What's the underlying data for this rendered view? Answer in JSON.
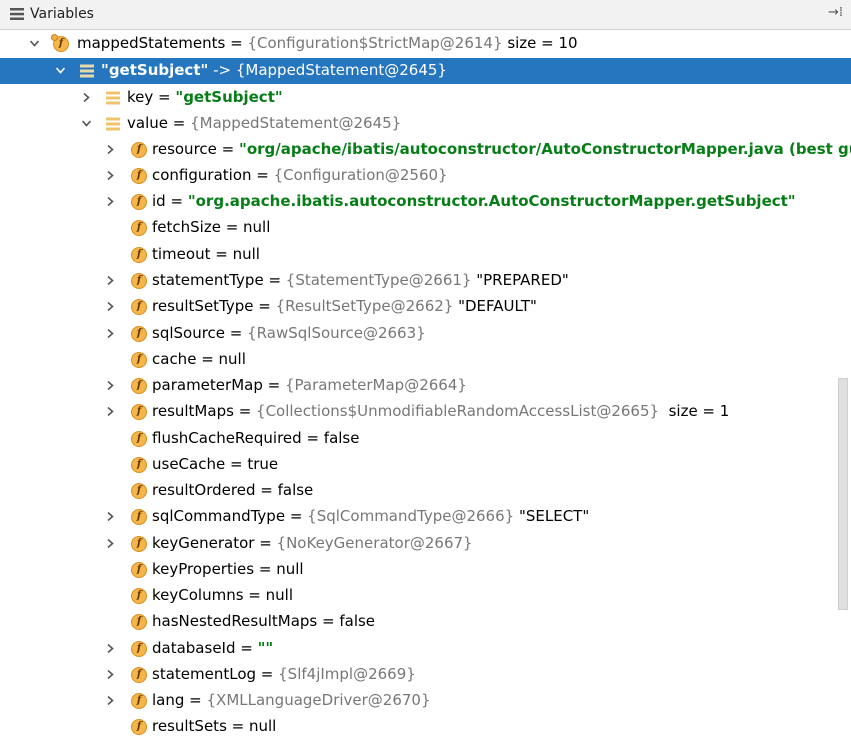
{
  "header": {
    "title": "Variables",
    "pin_glyph": "→⁞"
  },
  "tree": {
    "mappedStatements": {
      "name": "mappedStatements",
      "eq": " = ",
      "type": "{Configuration$StrictMap@2614}",
      "extra": "size = 10"
    },
    "entry": {
      "key": "\"getSubject\"",
      "arrow": " -> ",
      "type": "{MappedStatement@2645}"
    },
    "key": {
      "name": "key",
      "eq": " = ",
      "value": "\"getSubject\""
    },
    "value": {
      "name": "value",
      "eq": " = ",
      "type": "{MappedStatement@2645}"
    },
    "fields": [
      {
        "name": "resource",
        "eq": " = ",
        "str": "\"org/apache/ibatis/autoconstructor/AutoConstructorMapper.java (best guess)\"",
        "type": "",
        "plain": ""
      },
      {
        "name": "configuration",
        "eq": " = ",
        "str": "",
        "type": "{Configuration@2560}",
        "plain": ""
      },
      {
        "name": "id",
        "eq": " = ",
        "str": "\"org.apache.ibatis.autoconstructor.AutoConstructorMapper.getSubject\"",
        "type": "",
        "plain": ""
      },
      {
        "name": "fetchSize",
        "eq": " = ",
        "str": "",
        "type": "",
        "plain": "null"
      },
      {
        "name": "timeout",
        "eq": " = ",
        "str": "",
        "type": "",
        "plain": "null"
      },
      {
        "name": "statementType",
        "eq": " = ",
        "str": "",
        "type": "{StatementType@2661}",
        "plain": " \"PREPARED\""
      },
      {
        "name": "resultSetType",
        "eq": " = ",
        "str": "",
        "type": "{ResultSetType@2662}",
        "plain": " \"DEFAULT\""
      },
      {
        "name": "sqlSource",
        "eq": " = ",
        "str": "",
        "type": "{RawSqlSource@2663}",
        "plain": ""
      },
      {
        "name": "cache",
        "eq": " = ",
        "str": "",
        "type": "",
        "plain": "null"
      },
      {
        "name": "parameterMap",
        "eq": " = ",
        "str": "",
        "type": "{ParameterMap@2664}",
        "plain": ""
      },
      {
        "name": "resultMaps",
        "eq": " = ",
        "str": "",
        "type": "{Collections$UnmodifiableRandomAccessList@2665}",
        "plain": "  size = 1"
      },
      {
        "name": "flushCacheRequired",
        "eq": " = ",
        "str": "",
        "type": "",
        "plain": "false"
      },
      {
        "name": "useCache",
        "eq": " = ",
        "str": "",
        "type": "",
        "plain": "true"
      },
      {
        "name": "resultOrdered",
        "eq": " = ",
        "str": "",
        "type": "",
        "plain": "false"
      },
      {
        "name": "sqlCommandType",
        "eq": " = ",
        "str": "",
        "type": "{SqlCommandType@2666}",
        "plain": " \"SELECT\""
      },
      {
        "name": "keyGenerator",
        "eq": " = ",
        "str": "",
        "type": "{NoKeyGenerator@2667}",
        "plain": ""
      },
      {
        "name": "keyProperties",
        "eq": " = ",
        "str": "",
        "type": "",
        "plain": "null"
      },
      {
        "name": "keyColumns",
        "eq": " = ",
        "str": "",
        "type": "",
        "plain": "null"
      },
      {
        "name": "hasNestedResultMaps",
        "eq": " = ",
        "str": "",
        "type": "",
        "plain": "false"
      },
      {
        "name": "databaseId",
        "eq": " = ",
        "str": "\"\"",
        "type": "",
        "plain": ""
      },
      {
        "name": "statementLog",
        "eq": " = ",
        "str": "",
        "type": "{Slf4jImpl@2669}",
        "plain": ""
      },
      {
        "name": "lang",
        "eq": " = ",
        "str": "",
        "type": "{XMLLanguageDriver@2670}",
        "plain": ""
      },
      {
        "name": "resultSets",
        "eq": " = ",
        "str": "",
        "type": "",
        "plain": "null"
      }
    ]
  }
}
